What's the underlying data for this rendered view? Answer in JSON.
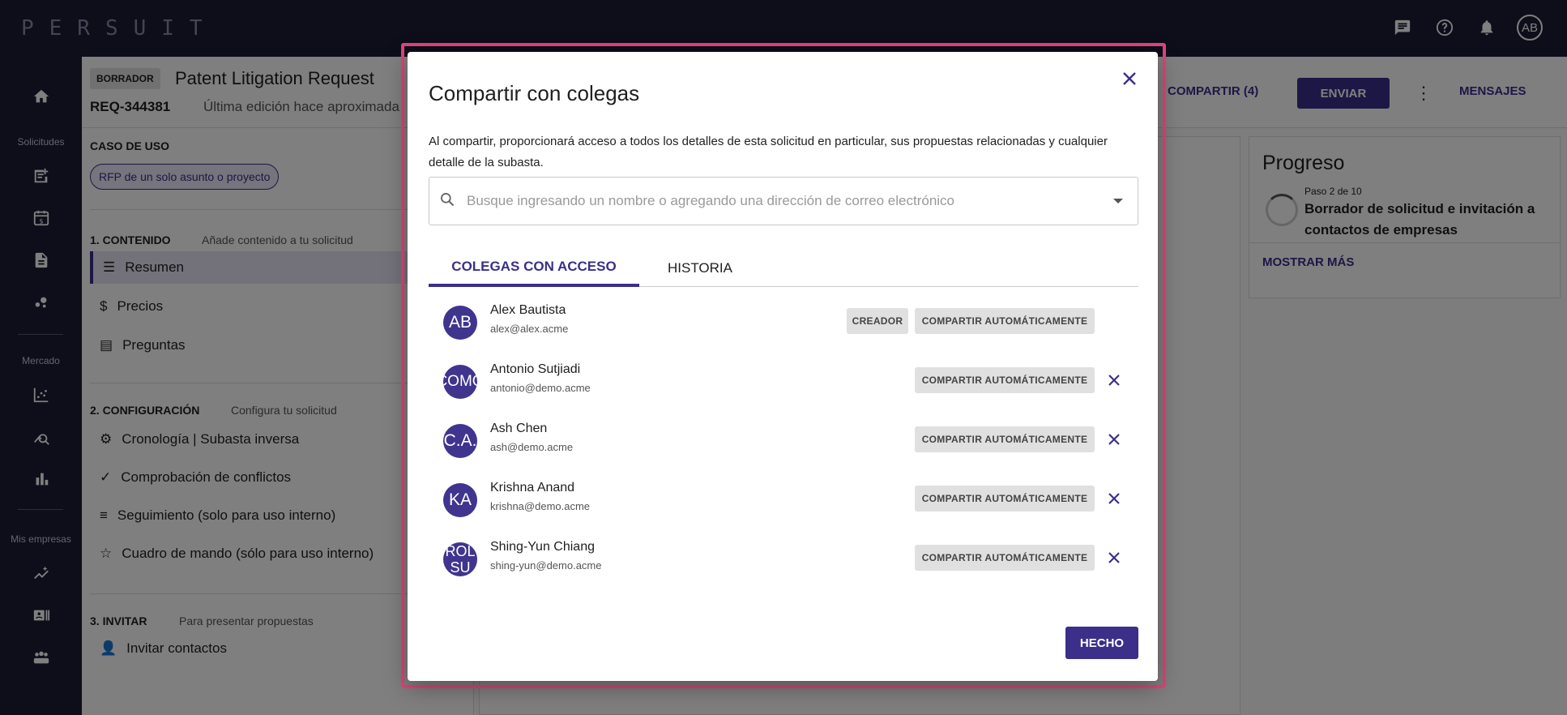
{
  "app": {
    "logo": "PERSUIT",
    "avatar_initials": "AB"
  },
  "rail": {
    "sections": [
      "Solicitudes",
      "Mercado",
      "Mis empresas"
    ]
  },
  "request": {
    "status": "BORRADOR",
    "title": "Patent Litigation Request",
    "id": "REQ-344381",
    "last_edit": "Última edición hace aproximada",
    "share_label": "COMPARTIR (4)",
    "send_label": "ENVIAR",
    "messages_label": "MENSAJES"
  },
  "left": {
    "use_case_label": "CASO DE USO",
    "use_case_value": "RFP de un solo asunto o proyecto",
    "content_title": "1. CONTENIDO",
    "content_sub": "Añade contenido a tu solicitud",
    "content_items": [
      "Resumen",
      "Precios",
      "Preguntas"
    ],
    "config_title": "2. CONFIGURACIÓN",
    "config_sub": "Configura tu solicitud",
    "config_items": [
      "Cronología | Subasta inversa",
      "Comprobación de conflictos",
      "Seguimiento (solo para uso interno)",
      "Cuadro de mando (sólo para uso interno)"
    ],
    "invite_title": "3. INVITAR",
    "invite_sub": "Para presentar propuestas",
    "invite_item": "Invitar contactos"
  },
  "progress": {
    "title": "Progreso",
    "step": "Paso 2 de 10",
    "desc": "Borrador de solicitud e invitación a contactos de empresas",
    "more": "MOSTRAR MÁS"
  },
  "modal": {
    "title": "Compartir con colegas",
    "description": "Al compartir, proporcionará acceso a todos los detalles de esta solicitud en particular, sus propuestas relacionadas y cualquier detalle de la subasta.",
    "search_placeholder": "Busque ingresando un nombre o agregando una dirección de correo electrónico",
    "tabs": [
      "COLEGAS CON ACCESO",
      "HISTORIA"
    ],
    "creator_label": "CREADOR",
    "auto_share_label": "COMPARTIR AUTOMÁTICAMENTE",
    "done_label": "HECHO",
    "people": [
      {
        "initials": "AB",
        "name": "Alex Bautista",
        "email": "alex@alex.acme"
      },
      {
        "initials": "COMO",
        "name": "Antonio Sutjiadi",
        "email": "antonio@demo.acme"
      },
      {
        "initials": "C.A.",
        "name": "Ash Chen",
        "email": "ash@demo.acme"
      },
      {
        "initials": "KA",
        "name": "Krishna Anand",
        "email": "krishna@demo.acme"
      },
      {
        "initials": "ROL SU",
        "name": "Shing-Yun Chiang",
        "email": "shing-yun@demo.acme"
      }
    ]
  },
  "colors": {
    "accent": "#3b2f8a",
    "frame": "#e0457b",
    "nav_bg": "#1d1a35"
  }
}
